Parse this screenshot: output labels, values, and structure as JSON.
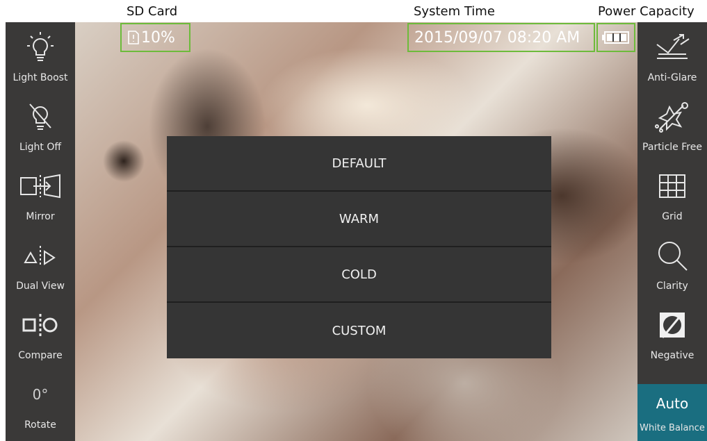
{
  "annotations": {
    "sd_card": "SD Card",
    "system_time": "System Time",
    "power_capacity": "Power Capacity"
  },
  "status": {
    "sd_percent": "10%",
    "datetime": "2015/09/07 08:20 AM",
    "battery_level": 1.0
  },
  "left_sidebar": [
    {
      "label": "Light Boost",
      "icon": "light-boost-icon"
    },
    {
      "label": "Light Off",
      "icon": "light-off-icon"
    },
    {
      "label": "Mirror",
      "icon": "mirror-icon"
    },
    {
      "label": "Dual View",
      "icon": "dual-view-icon"
    },
    {
      "label": "Compare",
      "icon": "compare-icon"
    },
    {
      "label": "Rotate",
      "icon": "rotate-icon",
      "value": "0°"
    }
  ],
  "right_sidebar": [
    {
      "label": "Anti-Glare",
      "icon": "anti-glare-icon"
    },
    {
      "label": "Particle Free",
      "icon": "particle-free-icon"
    },
    {
      "label": "Grid",
      "icon": "grid-icon"
    },
    {
      "label": "Clarity",
      "icon": "clarity-icon"
    },
    {
      "label": "Negative",
      "icon": "negative-icon"
    },
    {
      "label": "White Balance",
      "value": "Auto",
      "active": true
    }
  ],
  "white_balance_menu": [
    "DEFAULT",
    "WARM",
    "COLD",
    "CUSTOM"
  ],
  "colors": {
    "highlight_border": "#6dbb3b",
    "active_teal": "#1a6e80",
    "menu_bg": "#353535"
  }
}
